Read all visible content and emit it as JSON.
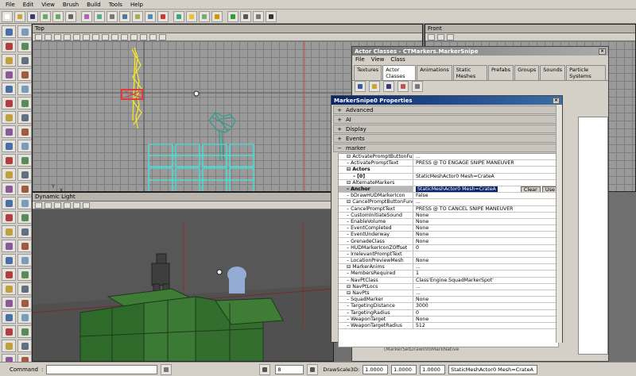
{
  "menu": [
    "File",
    "Edit",
    "View",
    "Brush",
    "Build",
    "Tools",
    "Help"
  ],
  "toolbar_icons": [
    "new-icon",
    "open-icon",
    "save-icon",
    "undo-icon",
    "redo-icon",
    "find-icon",
    "textures-icon",
    "actors-icon",
    "meshes-icon",
    "groups-icon",
    "prefabs-icon",
    "sounds-icon",
    "font-icon",
    "build-geometry-icon",
    "build-lighting-icon",
    "build-paths-icon",
    "build-all-icon",
    "play-icon",
    "scripts-icon",
    "options-icon",
    "actor-icon"
  ],
  "viewports": {
    "top": {
      "title": "Top"
    },
    "front": {
      "title": "Front"
    },
    "dynamic": {
      "title": "Dynamic Light"
    }
  },
  "actor_classes": {
    "title": "Actor Classes - CTMarkers.MarkerSnipe",
    "menu": [
      "File",
      "View",
      "Class"
    ],
    "tabs": [
      "Textures",
      "Actor Classes",
      "Animations",
      "Static Meshes",
      "Prefabs",
      "Groups",
      "Sounds",
      "Particle Systems"
    ],
    "selected_tab": 1
  },
  "properties": {
    "title": "MarkerSnipe0 Properties",
    "categories": [
      {
        "label": "Advanced",
        "expanded": false
      },
      {
        "label": "AI",
        "expanded": false
      },
      {
        "label": "Display",
        "expanded": false
      },
      {
        "label": "Events",
        "expanded": false
      },
      {
        "label": "marker",
        "expanded": true
      }
    ],
    "rows": [
      {
        "name": "ActivatePromptButtonFuncs",
        "value": "...",
        "tree": "-"
      },
      {
        "name": "ActivatePromptText",
        "value": "PRESS @ TO ENGAGE SNIPE MANEUVER",
        "tree": ""
      },
      {
        "name": "Actors",
        "value": "",
        "tree": "-",
        "bold": true
      },
      {
        "name": "[0]",
        "value": "StaticMeshActor0 Mesh=CrateA",
        "tree": "",
        "bold": true,
        "indent": true
      },
      {
        "name": "AlternateMarkers",
        "value": "",
        "tree": "-"
      },
      {
        "name": "Anchor",
        "value": "StaticMeshActor0 Mesh=CrateA",
        "tree": "",
        "bold": true,
        "highlight": true
      },
      {
        "name": "bDrawHUDMarkerIcon",
        "value": "False",
        "tree": ""
      },
      {
        "name": "CancelPromptButtonFuncs",
        "value": "...",
        "tree": "-"
      },
      {
        "name": "CancelPromptText",
        "value": "PRESS @ TO CANCEL SNIPE MANEUVER",
        "tree": ""
      },
      {
        "name": "CustomInitiateSound",
        "value": "None",
        "tree": ""
      },
      {
        "name": "EnableVolume",
        "value": "None",
        "tree": ""
      },
      {
        "name": "EventCompleted",
        "value": "None",
        "tree": ""
      },
      {
        "name": "EventUnderway",
        "value": "None",
        "tree": ""
      },
      {
        "name": "GrenadeClass",
        "value": "None",
        "tree": ""
      },
      {
        "name": "HUDMarkerIconZOffset",
        "value": "0",
        "tree": ""
      },
      {
        "name": "IrrelevantPromptText",
        "value": "",
        "tree": ""
      },
      {
        "name": "LocationPreviewMesh",
        "value": "None",
        "tree": ""
      },
      {
        "name": "MarkerAnims",
        "value": "...",
        "tree": "-"
      },
      {
        "name": "MembersRequired",
        "value": "1",
        "tree": ""
      },
      {
        "name": "NavPtClass",
        "value": "Class'Engine.SquadMarkerSpot'",
        "tree": ""
      },
      {
        "name": "NavPtLocs",
        "value": "...",
        "tree": "-"
      },
      {
        "name": "NavPts",
        "value": "...",
        "tree": "-"
      },
      {
        "name": "SquadMarker",
        "value": "None",
        "tree": ""
      },
      {
        "name": "TargetingDistance",
        "value": "3000",
        "tree": ""
      },
      {
        "name": "TargetingRadius",
        "value": "0",
        "tree": ""
      },
      {
        "name": "WeaponTarget",
        "value": "None",
        "tree": ""
      },
      {
        "name": "WeaponTargetRadius",
        "value": "512",
        "tree": ""
      }
    ],
    "clear_label": "Clear",
    "use_label": "Use",
    "behind_text": "(MarkerSetDrawInfoMarkNative"
  },
  "statusbar": {
    "command_label": "Command",
    "grid_value": "8",
    "drawscale_label": "DrawScale3D:",
    "scale_x": "1.0000",
    "scale_y": "1.0000",
    "scale_z": "1.0000",
    "selection": "StaticMeshActor0 Mesh=CrateA"
  },
  "colors": {
    "selection": "#0a246a",
    "title_active": "#0a246a",
    "crate": "#2e6a2a",
    "wire_cyan": "#40e8e0"
  }
}
